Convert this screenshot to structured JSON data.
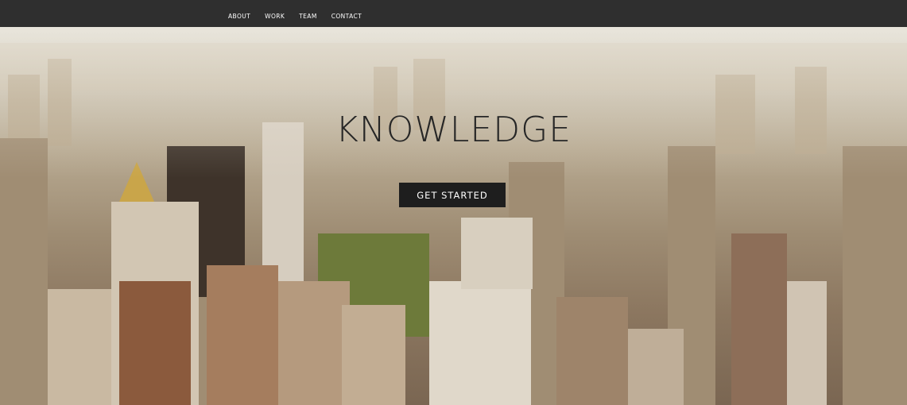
{
  "nav": {
    "items": [
      {
        "label": "ABOUT"
      },
      {
        "label": "WORK"
      },
      {
        "label": "TEAM"
      },
      {
        "label": "CONTACT"
      }
    ]
  },
  "hero": {
    "title": "KNOWLEDGE",
    "cta_label": "GET STARTED",
    "background_image": "aerial-city-skyline-photo"
  },
  "colors": {
    "navbar_bg": "#2f2f2f",
    "nav_text": "#ffffff",
    "title_text": "#262626",
    "button_bg": "#1e1e1e",
    "button_text": "#ffffff"
  }
}
